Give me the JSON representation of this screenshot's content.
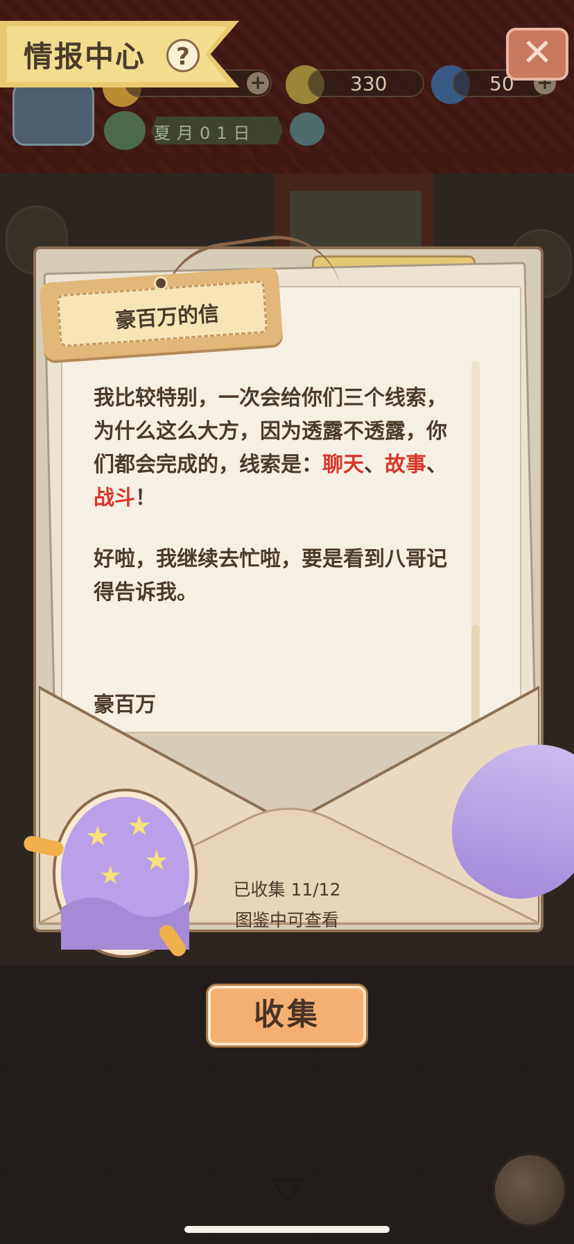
{
  "hud": {
    "title": "情报中心",
    "help": "?",
    "close": "✕",
    "resources": {
      "clover": "330",
      "banana": "50",
      "plus": "+"
    },
    "date": "夏月01日"
  },
  "letter": {
    "title": "豪百万的信",
    "para1_a": "我比较特别，一次会给你们三个线索，为什么这么大方，因为透露不透露，你们都会完成的，线索是：",
    "kw1": "聊天",
    "sep1": "、",
    "kw2": "故事",
    "sep2": "、",
    "kw3": "战斗",
    "para1_end": "！",
    "para2": "好啦，我继续去忙啦，要是看到八哥记得告诉我。",
    "signature": "豪百万"
  },
  "collection": {
    "line1": "已收集 11/12",
    "line2": "图鉴中可查看"
  },
  "buttons": {
    "collect": "收集"
  },
  "colors": {
    "keyword": "#d8352a",
    "text": "#4a3a2a",
    "button": "#f4b072"
  }
}
